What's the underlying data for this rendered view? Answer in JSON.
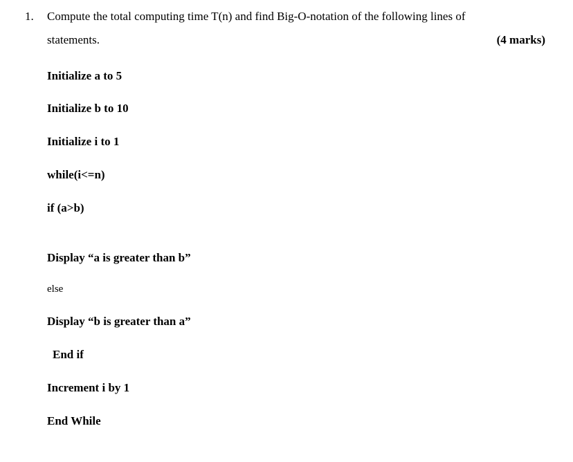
{
  "question": {
    "number": "1.",
    "prompt_line1": "Compute the total computing time T(n) and find Big-O-notation of the following lines of",
    "prompt_line2": "statements.",
    "marks": "(4 marks)"
  },
  "code": {
    "lines": [
      "Initialize a to 5",
      "Initialize b to 10",
      "Initialize i to 1",
      "while(i<=n)",
      "if (a>b)",
      "Display “a is greater than b”",
      "else",
      "Display “b is greater than a”",
      "End if",
      "Increment i by 1",
      "End While"
    ]
  }
}
